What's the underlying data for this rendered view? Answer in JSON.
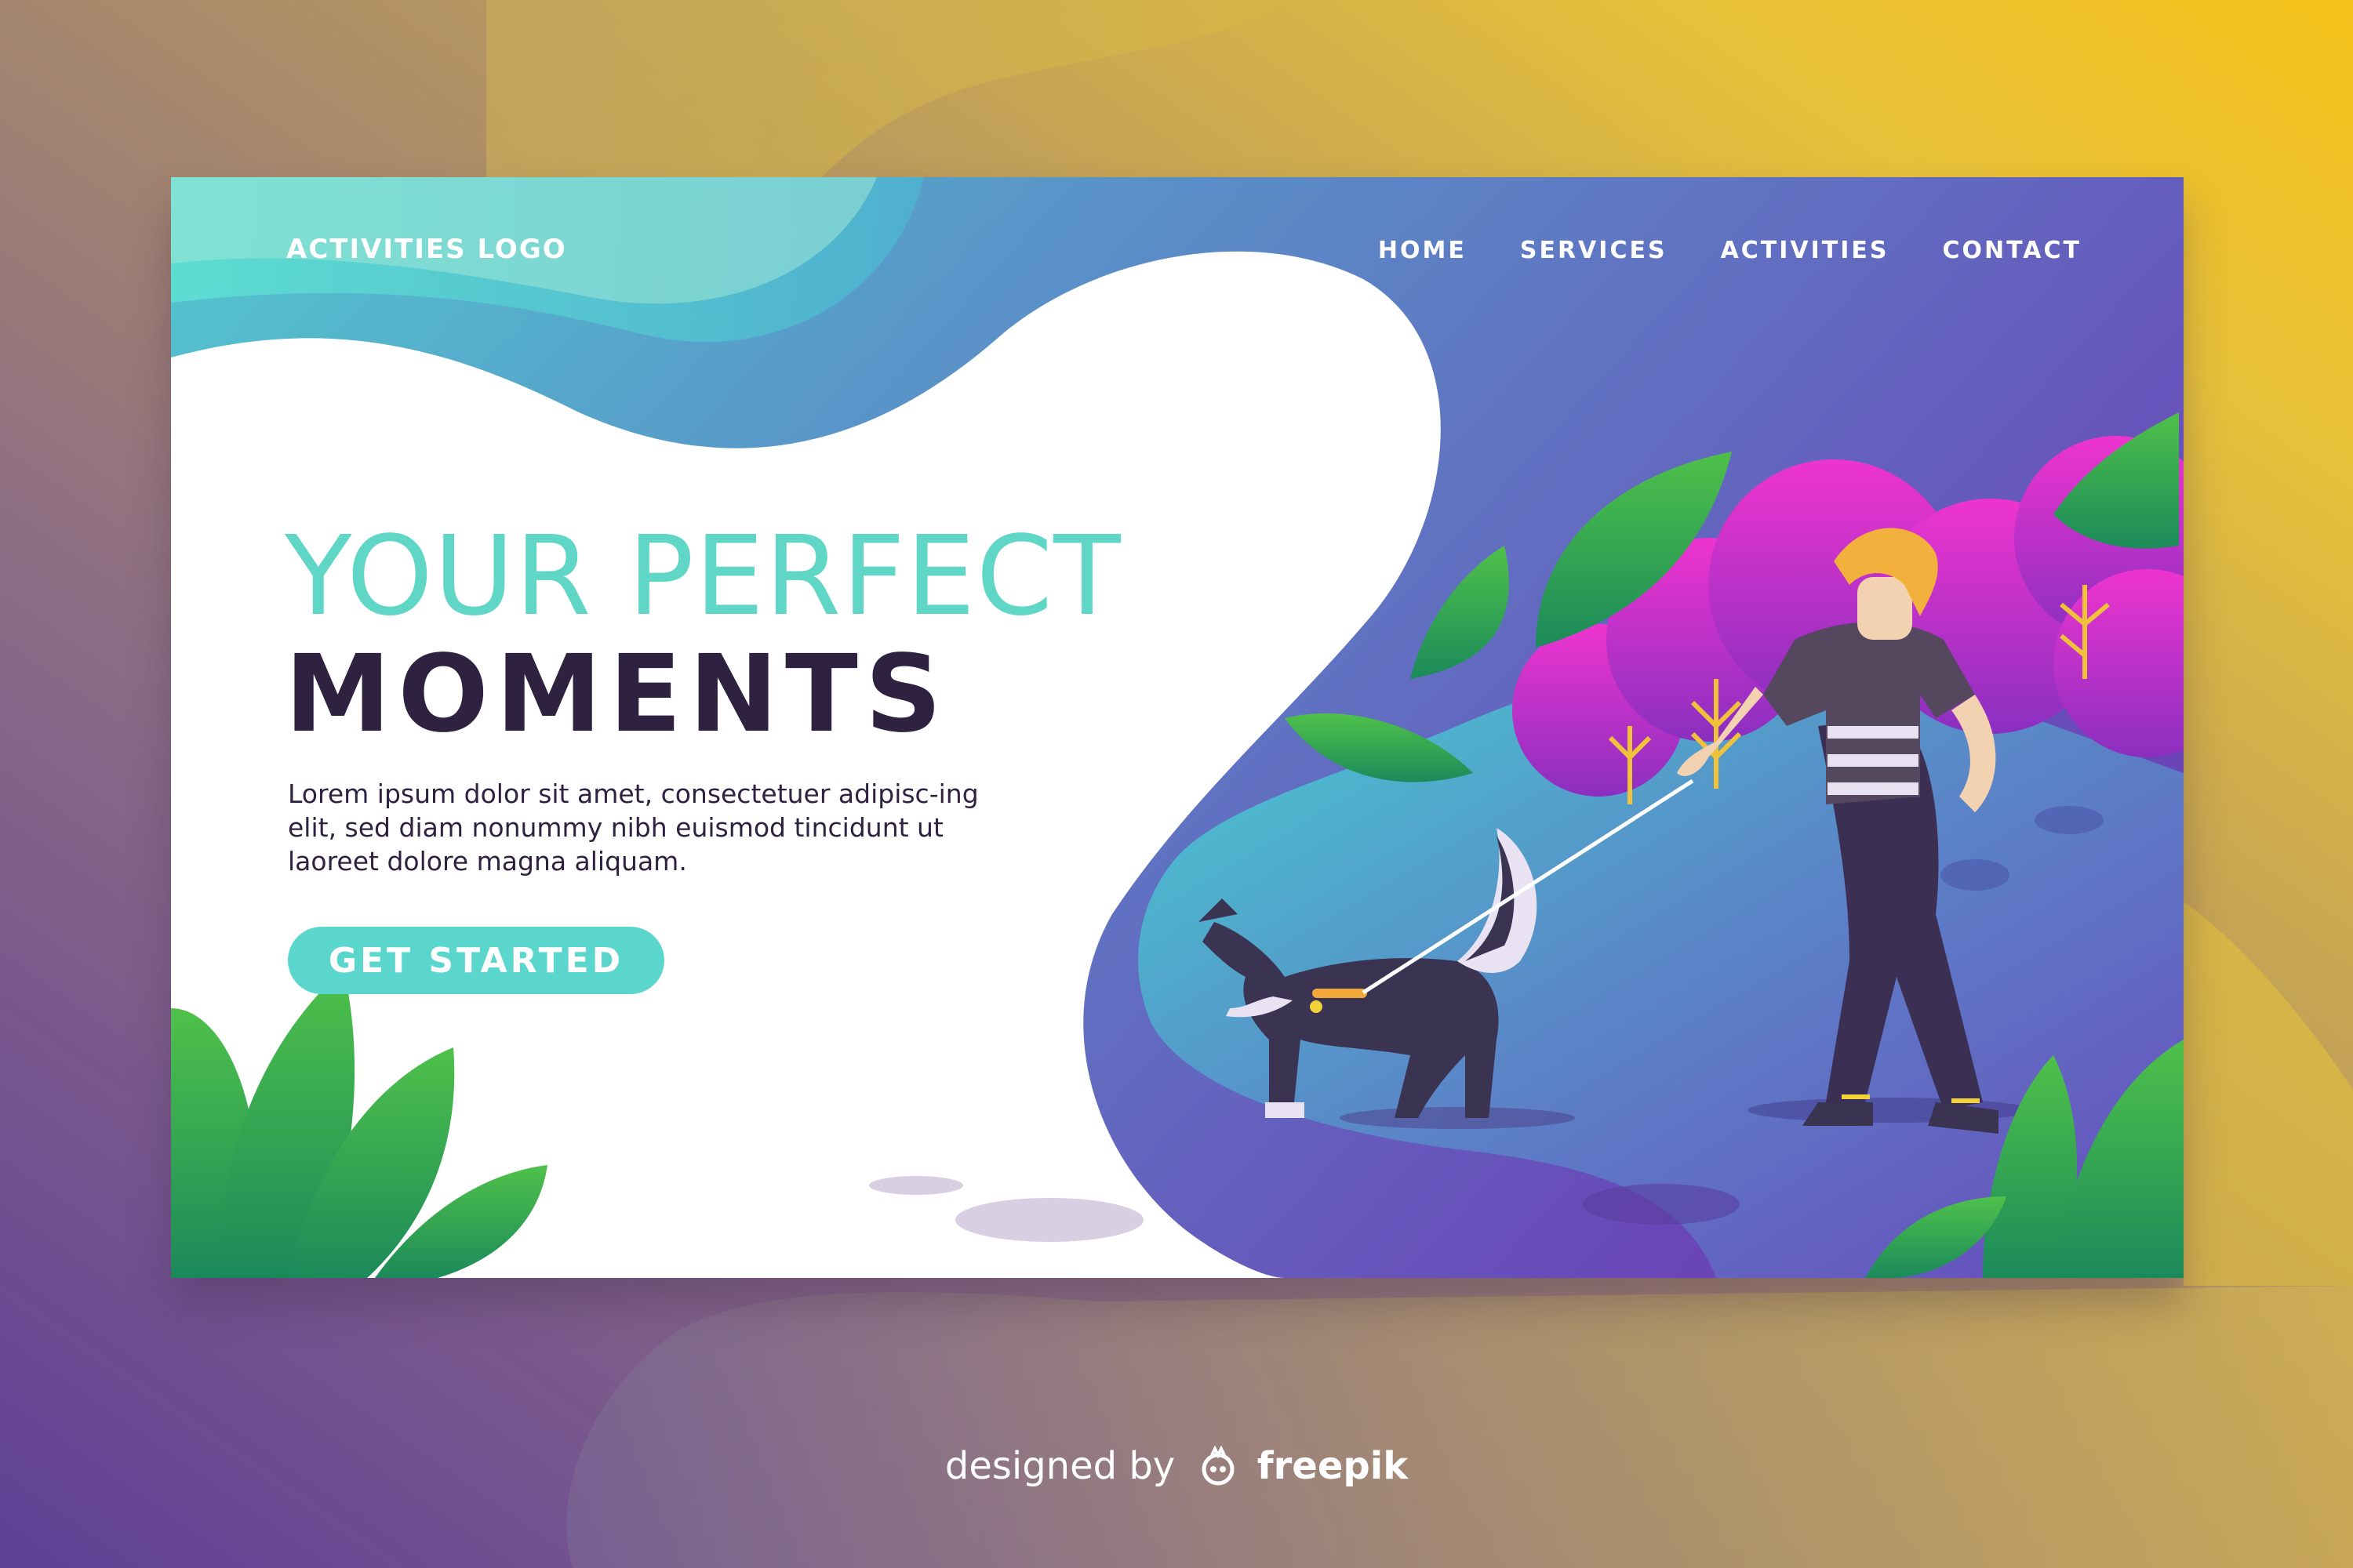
{
  "header": {
    "logo": "ACTIVITIES LOGO",
    "nav": [
      "HOME",
      "SERVICES",
      "ACTIVITIES",
      "CONTACT"
    ]
  },
  "hero": {
    "headline_light": "YOUR PERFECT",
    "headline_bold": "MOMENTS",
    "body": "Lorem ipsum dolor sit amet, consectetuer adipisc-ing elit, sed diam nonummy nibh euismod tincidunt ut laoreet dolore magna aliquam.",
    "cta": "GET STARTED"
  },
  "illustration": {
    "subject": "person walking a dog on a leash among plants and bushes"
  },
  "credit": {
    "prefix": "designed by",
    "brand": "freepik"
  },
  "colors": {
    "accent_teal": "#5ad6cc",
    "headline_light": "#5fd6c6",
    "dark_text": "#2f2240",
    "gradient_blue": "#5b8cc8",
    "gradient_purple": "#6f47b8",
    "bush_magenta": "#c33ad0",
    "leaf_green": "#3fb04a",
    "background_gold": "#f5c11a",
    "background_purple": "#5f3f96"
  }
}
